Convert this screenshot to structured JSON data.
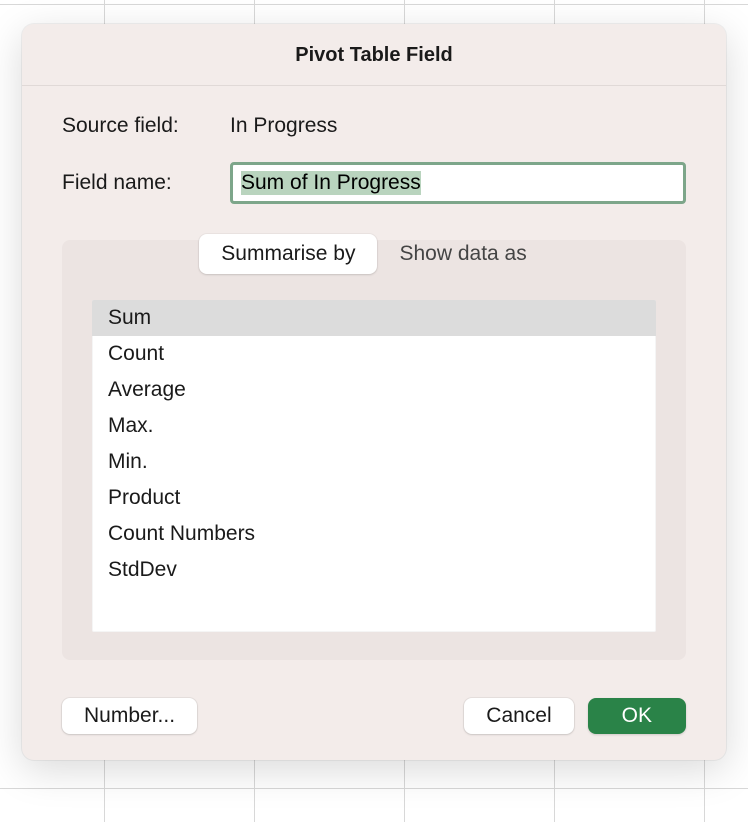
{
  "dialog": {
    "title": "Pivot Table Field",
    "source_field_label": "Source field:",
    "source_field_value": "In Progress",
    "field_name_label": "Field name:",
    "field_name_value": "Sum of In Progress"
  },
  "tabs": {
    "summarise": "Summarise by",
    "showdata": "Show data as"
  },
  "functions": [
    "Sum",
    "Count",
    "Average",
    "Max.",
    "Min.",
    "Product",
    "Count Numbers",
    "StdDev"
  ],
  "buttons": {
    "number": "Number...",
    "cancel": "Cancel",
    "ok": "OK"
  }
}
